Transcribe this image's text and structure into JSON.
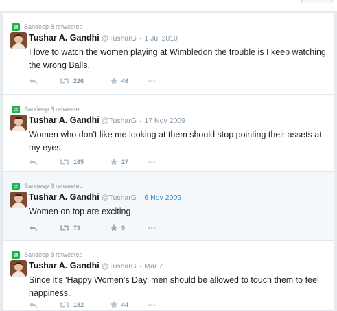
{
  "colors": {
    "retweet_green": "#19b34a",
    "meta_gray": "#8899a6",
    "link_blue": "#3b88c3",
    "name_dark": "#14171a",
    "highlight_bg": "#f5f8fa"
  },
  "icons": {
    "retweeted": "retweet-icon",
    "reply": "reply-icon",
    "retweet": "retweet-icon",
    "favorite": "star-icon",
    "more": "more-icon"
  },
  "tweets": [
    {
      "retweeted_by": "Sandeep 8 retweeted",
      "name": "Tushar A. Gandhi",
      "handle": "@TusharG",
      "separator": "·",
      "time": "1 Jul 2010",
      "text": "I love to watch the women playing at Wimbledon the trouble is I keep watching the wrong Balls.",
      "retweets": "226",
      "favorites": "46",
      "more": "•••"
    },
    {
      "retweeted_by": "Sandeep 8 retweeted",
      "name": "Tushar A. Gandhi",
      "handle": "@TusharG",
      "separator": "·",
      "time": "17 Nov 2009",
      "text": "Women who don't like me looking at them should stop pointing their assets at my eyes.",
      "retweets": "165",
      "favorites": "27",
      "more": "•••"
    },
    {
      "retweeted_by": "Sandeep 8 retweeted",
      "name": "Tushar A. Gandhi",
      "handle": "@TusharG",
      "separator": "·",
      "time": "6 Nov 2009",
      "text": "Women on top are exciting.",
      "retweets": "73",
      "favorites": "9",
      "more": "•••"
    },
    {
      "retweeted_by": "Sandeep 8 retweeted",
      "name": "Tushar A. Gandhi",
      "handle": "@TusharG",
      "separator": "·",
      "time": "Mar 7",
      "text": "Since it's 'Happy Women's Day' men should be allowed to touch them to feel happiness.",
      "retweets": "182",
      "favorites": "44",
      "more": "•••"
    }
  ]
}
